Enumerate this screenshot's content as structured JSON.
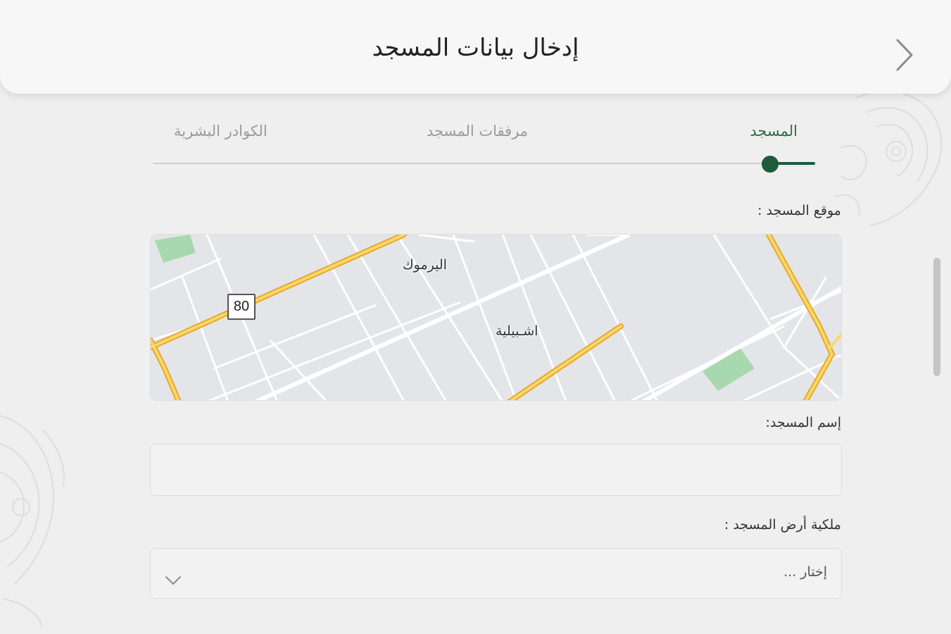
{
  "header": {
    "title": "إدخال بيانات المسجد",
    "back_icon": "chevron-right-icon"
  },
  "stepper": {
    "steps": [
      {
        "label": "المسجد",
        "state": "active"
      },
      {
        "label": "مرفقات المسجد",
        "state": "pending"
      },
      {
        "label": "الكوادر البشرية",
        "state": "pending"
      }
    ],
    "progress": 0.07,
    "active_color": "#1f5a3c"
  },
  "form": {
    "location_label": "موقع المسجد :",
    "map": {
      "labels": [
        "اليرموك",
        "اشـبيلية"
      ],
      "route_number": "80"
    },
    "name_label": "إسم المسجد:",
    "name_value": "",
    "ownership_label": "ملكية أرض المسجد :",
    "ownership_placeholder": "إختار ...",
    "ownership_chevron_icon": "chevron-down-icon"
  },
  "colors": {
    "accent": "#1f5a3c",
    "step_active_text": "#2e6b46",
    "map_road_major": "#f5c242",
    "map_park": "#a8d8ae"
  }
}
